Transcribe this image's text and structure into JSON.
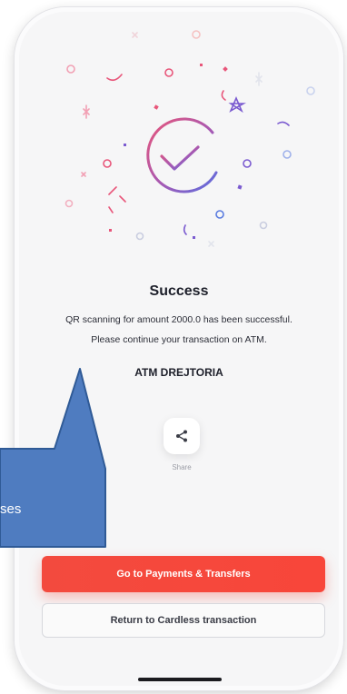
{
  "success": {
    "title": "Success",
    "message_line1": "QR scanning for amount 2000.0 has been successful.",
    "message_line2": "Please continue your transaction on ATM.",
    "atm_name": "ATM DREJTORIA"
  },
  "share": {
    "label": "Share",
    "icon": "share-icon"
  },
  "actions": {
    "primary_label": "Go to Payments & Transfers",
    "secondary_label": "Return to Cardless transaction"
  },
  "callout": {
    "text": "ses"
  },
  "colors": {
    "accent_red": "#f34a3e",
    "confetti_pink": "#e8567a",
    "confetti_purple": "#7b5bd0",
    "confetti_blue": "#5a7ce0",
    "callout_fill": "#4f7cc0",
    "callout_border": "#2f5a96"
  }
}
